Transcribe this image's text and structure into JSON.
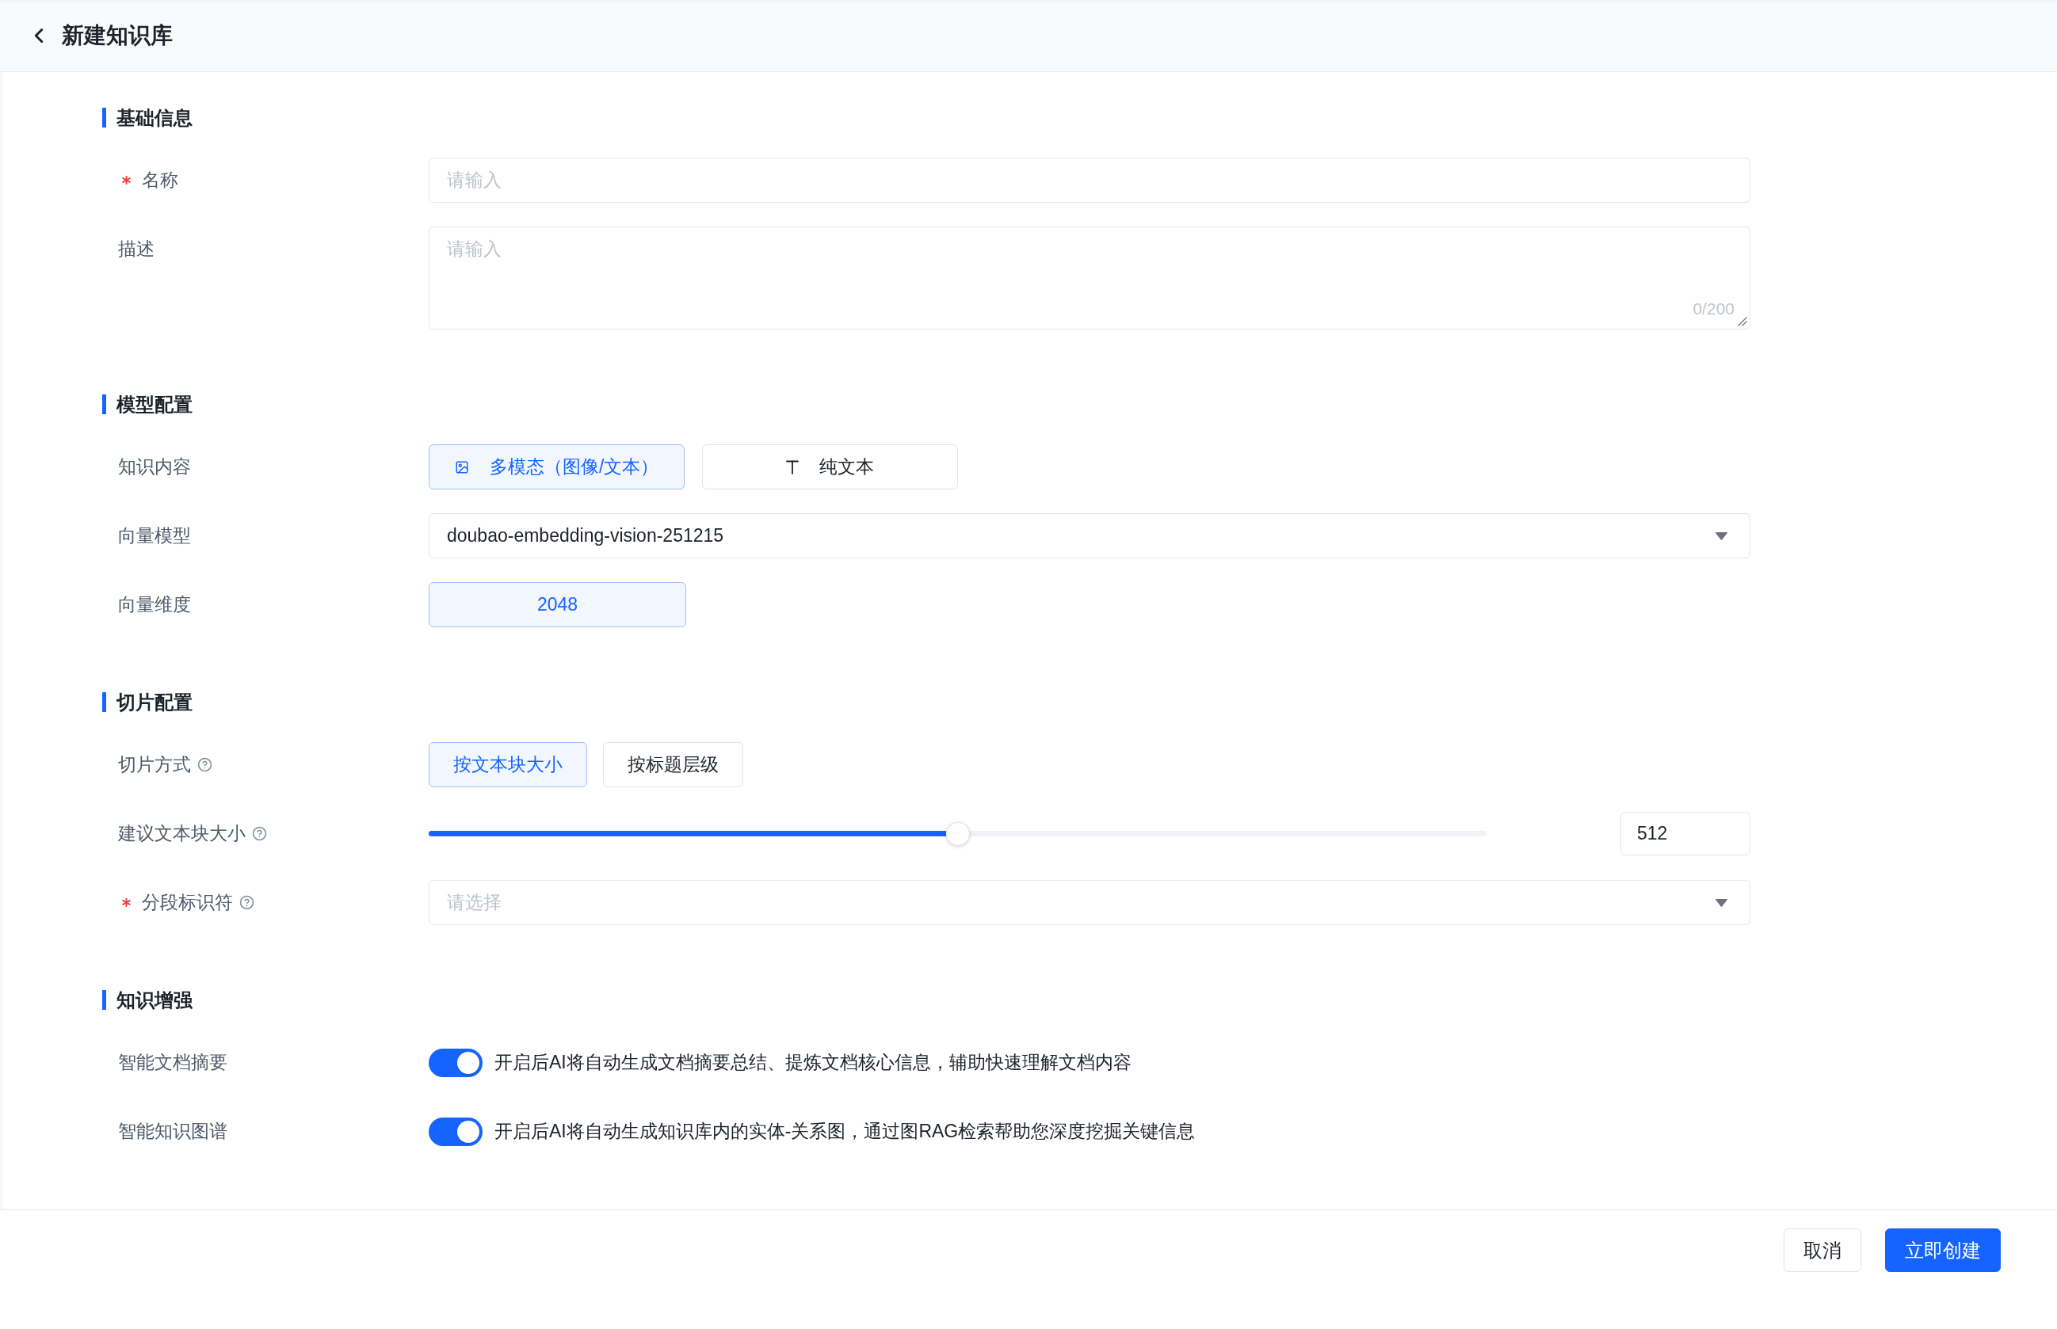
{
  "header": {
    "title": "新建知识库"
  },
  "sections": [
    {
      "title": "基础信息",
      "fields": [
        {
          "kind": "input",
          "label": "名称",
          "required": true,
          "help": false,
          "placeholder": "请输入"
        },
        {
          "kind": "textarea",
          "label": "描述",
          "required": false,
          "help": false,
          "placeholder": "请输入",
          "counter": "0/200"
        }
      ]
    },
    {
      "title": "模型配置",
      "fields": [
        {
          "kind": "icon_options",
          "label": "知识内容",
          "required": false,
          "help": false,
          "options": [
            {
              "label": "多模态（图像/文本）",
              "selected": true
            },
            {
              "label": "纯文本",
              "selected": false
            }
          ]
        },
        {
          "kind": "select",
          "label": "向量模型",
          "required": false,
          "help": false,
          "value": "doubao-embedding-vision-251215"
        },
        {
          "kind": "display",
          "label": "向量维度",
          "required": false,
          "help": false,
          "value": "2048"
        }
      ]
    },
    {
      "title": "切片配置",
      "fields": [
        {
          "kind": "options",
          "label": "切片方式",
          "required": false,
          "help": true,
          "options": [
            {
              "label": "按文本块大小",
              "selected": true
            },
            {
              "label": "按标题层级",
              "selected": false
            }
          ]
        },
        {
          "kind": "slider",
          "label": "建议文本块大小",
          "required": false,
          "help": true,
          "level": 0.5,
          "value": "512"
        },
        {
          "kind": "select",
          "label": "分段标识符",
          "required": true,
          "help": true,
          "placeholder": "请选择"
        }
      ]
    },
    {
      "title": "知识增强",
      "fields": [
        {
          "kind": "switch",
          "label": "智能文档摘要",
          "required": false,
          "help": false,
          "on": true,
          "description": "开启后AI将自动生成文档摘要总结、提炼文档核心信息，辅助快速理解文档内容"
        },
        {
          "kind": "switch",
          "label": "智能知识图谱",
          "required": false,
          "help": false,
          "on": true,
          "description": "开启后AI将自动生成知识库内的实体-关系图，通过图RAG检索帮助您深度挖掘关键信息"
        }
      ]
    }
  ],
  "footer": {
    "buttons": [
      {
        "label": "取消",
        "kind": "secondary"
      },
      {
        "label": "立即创建",
        "kind": "primary"
      }
    ]
  }
}
